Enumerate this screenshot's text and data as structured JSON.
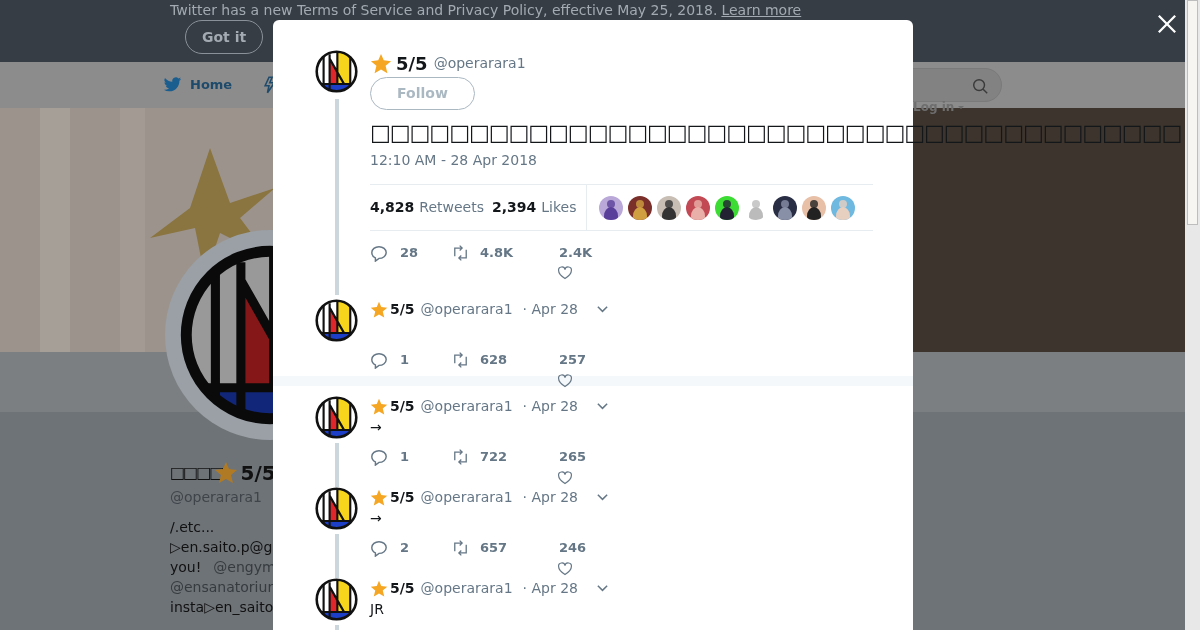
{
  "banner": {
    "text": "Twitter has a new Terms of Service and Privacy Policy, effective May 25, 2018.",
    "link": "Learn more",
    "button": "Got it"
  },
  "nav": {
    "home": "Home",
    "login": "Log in"
  },
  "profile": {
    "name": "□□□□",
    "badge_name": "5/5",
    "handle": "@operarara1",
    "bio_lines": [
      [
        {
          "kind": "text",
          "text": "/.etc..."
        }
      ],
      [
        {
          "kind": "text",
          "text": "▷en.saito.p@g"
        }
      ],
      [
        {
          "kind": "text",
          "text": "you!"
        },
        {
          "kind": "mention",
          "text": "@engym"
        }
      ],
      [
        {
          "kind": "mention",
          "text": "@ensanatoriur"
        }
      ],
      [
        {
          "kind": "text",
          "text": "insta▷en_saito"
        }
      ]
    ]
  },
  "tweet": {
    "name": "5/5",
    "handle": "@operarara1",
    "follow": "Follow",
    "text": "□□□□□□□□□□□□□□□□□□□□□□□□□□□□□□□□□□□□□□□□□",
    "time": "12:10 AM - 28 Apr 2018",
    "retweets": "4,828",
    "retweets_label": "Retweets",
    "likes": "2,394",
    "likes_label": "Likes",
    "reply_count": "28",
    "retweet_count": "4.8K",
    "like_count": "2.4K"
  },
  "replies": [
    {
      "name": "5/5",
      "handle": "@operarara1",
      "date": "· Apr 28",
      "reply_count": "1",
      "retweet_count": "628",
      "like_count": "257",
      "separated": true
    },
    {
      "name": "5/5",
      "handle": "@operarara1",
      "date": "· Apr 28",
      "text": "→",
      "reply_count": "1",
      "retweet_count": "722",
      "like_count": "265",
      "separated": false
    },
    {
      "name": "5/5",
      "handle": "@operarara1",
      "date": "· Apr 28",
      "text": "→",
      "reply_count": "2",
      "retweet_count": "657",
      "like_count": "246",
      "separated": false
    },
    {
      "name": "5/5",
      "handle": "@operarara1",
      "date": "· Apr 28",
      "text": "JR",
      "separated": false
    }
  ]
}
